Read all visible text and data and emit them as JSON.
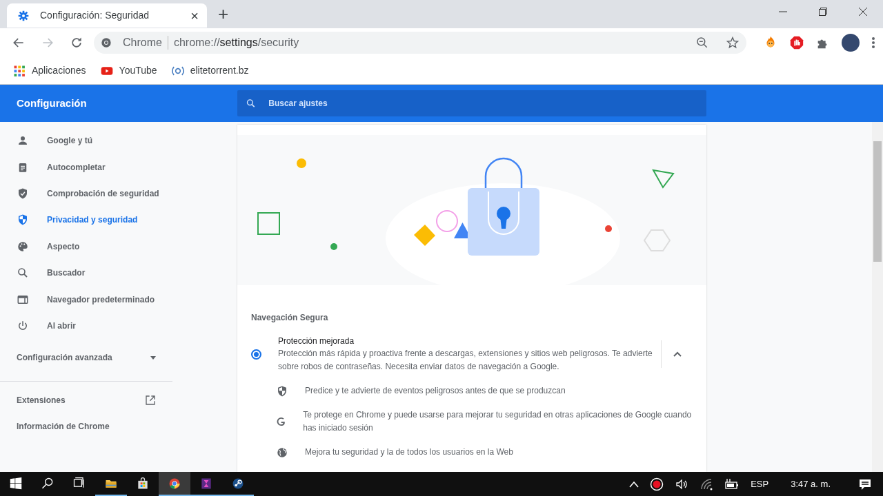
{
  "browser": {
    "tab": {
      "title": "Configuración: Seguridad",
      "close": "×",
      "new_tab": "+"
    },
    "omnibox": {
      "origin": "Chrome",
      "url_parts": [
        {
          "text": "chrome://",
          "emphasis": false
        },
        {
          "text": "settings",
          "emphasis": true
        },
        {
          "text": "/security",
          "emphasis": false
        }
      ]
    },
    "bookmarks": [
      {
        "label": "Aplicaciones",
        "kind": "apps"
      },
      {
        "label": "YouTube",
        "kind": "youtube"
      },
      {
        "label": "elitetorrent.bz",
        "kind": "site"
      }
    ]
  },
  "settings": {
    "title": "Configuración",
    "search": {
      "placeholder": "Buscar ajustes"
    },
    "sidebar": {
      "items": [
        {
          "label": "Google y tú",
          "kind": "person",
          "selected": false
        },
        {
          "label": "Autocompletar",
          "kind": "clipboard",
          "selected": false
        },
        {
          "label": "Comprobación de seguridad",
          "kind": "shield-check",
          "selected": false
        },
        {
          "label": "Privacidad y seguridad",
          "kind": "shield",
          "selected": true
        },
        {
          "label": "Aspecto",
          "kind": "palette",
          "selected": false
        },
        {
          "label": "Buscador",
          "kind": "search",
          "selected": false
        },
        {
          "label": "Navegador predeterminado",
          "kind": "browser",
          "selected": false
        },
        {
          "label": "Al abrir",
          "kind": "power",
          "selected": false
        }
      ],
      "advanced": {
        "label": "Configuración avanzada",
        "expanded": false
      },
      "links": [
        {
          "label": "Extensiones",
          "external": true
        },
        {
          "label": "Información de Chrome",
          "external": false
        }
      ]
    },
    "safe_browsing": {
      "heading": "Navegación Segura",
      "options": [
        {
          "title": "Protección mejorada",
          "description": "Protección más rápida y proactiva frente a descargas, extensiones y sitios web peligrosos. Te advierte sobre robos de contraseñas. Necesita enviar datos de navegación a Google.",
          "selected": true,
          "expanded": true,
          "features": [
            {
              "kind": "shield",
              "text": "Predice y te advierte de eventos peligrosos antes de que se produzcan"
            },
            {
              "kind": "google",
              "text": "Te protege en Chrome y puede usarse para mejorar tu seguridad en otras aplicaciones de Google cuando has iniciado sesión"
            },
            {
              "kind": "globe",
              "text": "Mejora tu seguridad y la de todos los usuarios en la Web"
            }
          ]
        }
      ]
    }
  },
  "taskbar": {
    "apps": [
      {
        "kind": "explorer",
        "running": true,
        "selected": false
      },
      {
        "kind": "store",
        "running": false,
        "selected": false
      },
      {
        "kind": "chrome",
        "running": true,
        "selected": true
      },
      {
        "kind": "hourglass",
        "running": true,
        "selected": false
      },
      {
        "kind": "steam",
        "running": true,
        "selected": false
      }
    ],
    "language": "ESP",
    "time": "3:47 a. m."
  }
}
